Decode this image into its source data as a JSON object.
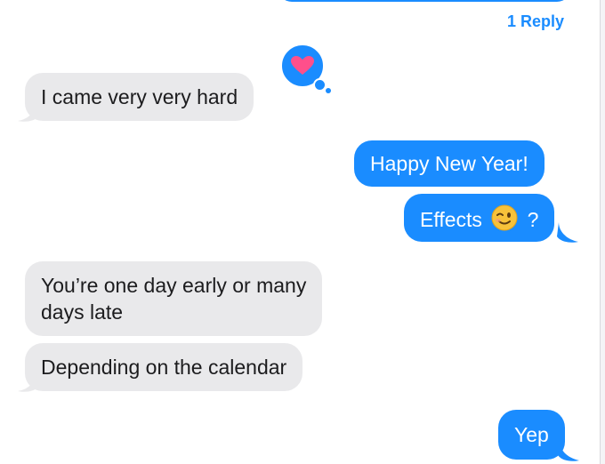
{
  "thread": {
    "reply_count_label": "1 Reply",
    "tapback_icon": "heart-icon",
    "colors": {
      "incoming": "#e9e9eb",
      "outgoing": "#1a8cff",
      "tapback_heart": "#ff4f8b"
    }
  },
  "messages": [
    {
      "direction": "incoming",
      "text": "I came very very hard"
    },
    {
      "direction": "outgoing",
      "text": "Happy New Year!"
    },
    {
      "direction": "outgoing",
      "text_before": "Effects",
      "emoji": "winking-face-emoji",
      "text_after": "?"
    },
    {
      "direction": "incoming",
      "line1": "You’re one day early or many",
      "line2": "days late"
    },
    {
      "direction": "incoming",
      "text": "Depending on the calendar"
    },
    {
      "direction": "outgoing",
      "text": "Yep"
    }
  ]
}
